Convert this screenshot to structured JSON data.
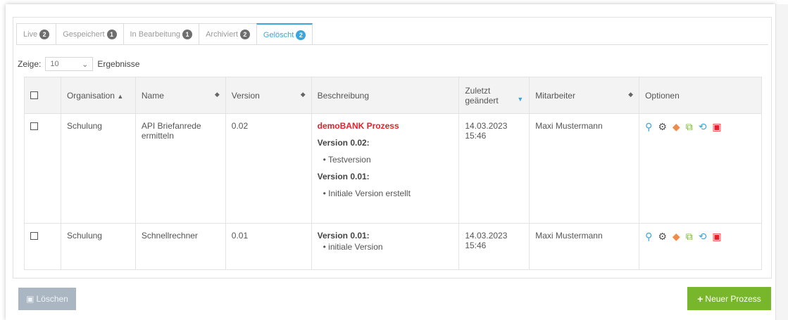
{
  "tabs": [
    {
      "label": "Live",
      "count": "2",
      "active": false
    },
    {
      "label": "Gespeichert",
      "count": "1",
      "active": false
    },
    {
      "label": "In Bearbeitung",
      "count": "1",
      "active": false
    },
    {
      "label": "Archiviert",
      "count": "2",
      "active": false
    },
    {
      "label": "Gelöscht",
      "count": "2",
      "active": true
    }
  ],
  "length": {
    "prefix": "Zeige:",
    "value": "10",
    "suffix": "Ergebnisse"
  },
  "table": {
    "headers": {
      "organisation": "Organisation",
      "name": "Name",
      "version": "Version",
      "beschreibung": "Beschreibung",
      "zuletzt": "Zuletzt geändert",
      "mitarbeiter": "Mitarbeiter",
      "optionen": "Optionen"
    },
    "rows": [
      {
        "organisation": "Schulung",
        "name": "API Briefanrede ermitteln",
        "version": "0.02",
        "desc_title": "demoBANK Prozess",
        "v1_label": "Version 0.02:",
        "v1_item": "Testversion",
        "v2_label": "Version 0.01:",
        "v2_item": "Initiale Version erstellt",
        "date": "14.03.2023",
        "time": "15:46",
        "mitarbeiter": "Maxi Mustermann"
      },
      {
        "organisation": "Schulung",
        "name": "Schnellrechner",
        "version": "0.01",
        "v1_label": "Version 0.01:",
        "v1_item": "initiale Version",
        "date": "14.03.2023",
        "time": "15:46",
        "mitarbeiter": "Maxi Mustermann"
      }
    ]
  },
  "icons": [
    "search-icon",
    "gears-icon",
    "tags-icon",
    "copy-icon",
    "undo-icon",
    "trash-icon"
  ],
  "buttons": {
    "delete": "Löschen",
    "new": "Neuer Prozess"
  },
  "colors": {
    "accent": "#3aa6dd",
    "danger": "#e8202a",
    "success": "#78b72b"
  }
}
